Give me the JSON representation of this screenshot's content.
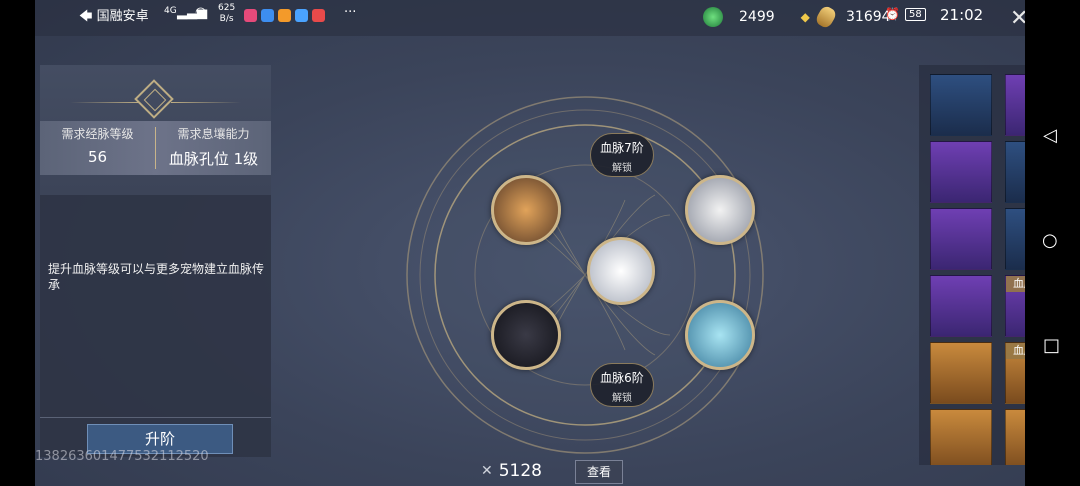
{
  "status_bar": {
    "carrier": "国融安卓",
    "signal": "4G",
    "speed_value": "625",
    "speed_unit": "B/s",
    "more": "···",
    "battery": "58",
    "time": "21:02"
  },
  "currencies": {
    "jade": "2499",
    "gold": "31694"
  },
  "requirements": {
    "level_label": "需求经脉等级",
    "level_value": "56",
    "ability_label": "需求息壤能力",
    "ability_value": "血脉孔位 1级"
  },
  "description": "提升血脉等级可以与更多宠物建立血脉传承",
  "upgrade_label": "升阶",
  "watermark": "13826360147753211252​0",
  "wheel": {
    "top_tag": {
      "title": "血脉7阶",
      "sub": "解锁"
    },
    "bottom_tag": {
      "title": "血脉6阶",
      "sub": "解锁"
    }
  },
  "pet_grid": [
    {
      "badge": ""
    },
    {
      "badge": ""
    },
    {
      "badge": ""
    },
    {
      "badge": ""
    },
    {
      "badge": ""
    },
    {
      "badge": ""
    },
    {
      "badge": ""
    },
    {
      "badge": "血脉"
    },
    {
      "badge": ""
    },
    {
      "badge": "血脉"
    },
    {
      "badge": ""
    },
    {
      "badge": ""
    }
  ],
  "bottom": {
    "count": "5128",
    "view_label": "查看"
  },
  "colors": {
    "accent_gold": "#cdb689",
    "bg": "#3b445a"
  }
}
